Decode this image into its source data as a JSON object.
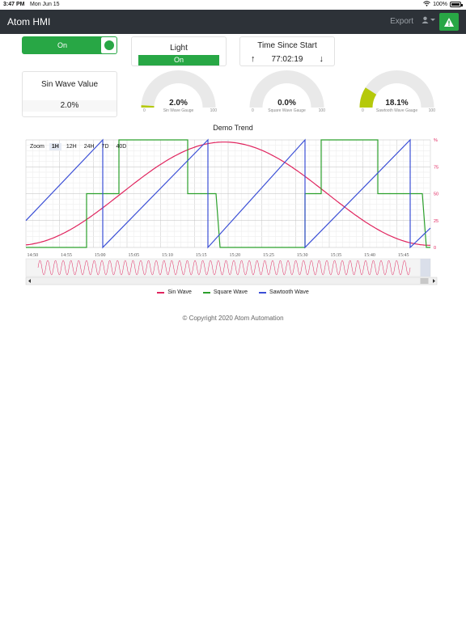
{
  "status": {
    "time": "3:47 PM",
    "date": "Mon Jun 15",
    "battery": "100%"
  },
  "navbar": {
    "brand": "Atom HMI",
    "export": "Export",
    "alert_icon": "warning-icon"
  },
  "toggle": {
    "label": "On",
    "state": true
  },
  "light": {
    "title": "Light",
    "value": "On"
  },
  "time_since_start": {
    "title": "Time Since Start",
    "value": "77:02:19"
  },
  "sin_value": {
    "title": "Sin Wave Value",
    "value": "2.0%"
  },
  "gauges": [
    {
      "name": "Sin Wave Gauge",
      "value": "2.0%",
      "fraction": 0.02,
      "min": "0",
      "max": "100"
    },
    {
      "name": "Square Wave Gauge",
      "value": "0.0%",
      "fraction": 0.0,
      "min": "0",
      "max": "100"
    },
    {
      "name": "Sawtooth Wave Gauge",
      "value": "18.1%",
      "fraction": 0.181,
      "min": "0",
      "max": "100"
    }
  ],
  "trend": {
    "title": "Demo Trend",
    "zoom_label": "Zoom",
    "zoom_options": [
      "1H",
      "12H",
      "24H",
      "7D",
      "40D"
    ],
    "zoom_active": "1H",
    "legend": [
      "Sin Wave",
      "Square Wave",
      "Sawtooth Wave"
    ]
  },
  "chart_data": {
    "type": "line",
    "x": [
      "14:50",
      "14:55",
      "15:00",
      "15:05",
      "15:10",
      "15:15",
      "15:20",
      "15:25",
      "15:30",
      "15:35",
      "15:40",
      "15:45"
    ],
    "y_ticks": [
      "0",
      "25",
      "50",
      "75",
      "%"
    ],
    "ylim": [
      0,
      100
    ],
    "series": [
      {
        "name": "Sin Wave",
        "color": "#e0245e"
      },
      {
        "name": "Square Wave",
        "color": "#2ca02c"
      },
      {
        "name": "Sawtooth Wave",
        "color": "#3b4fd6"
      }
    ]
  },
  "copyright": "© Copyright 2020 Atom Automation"
}
